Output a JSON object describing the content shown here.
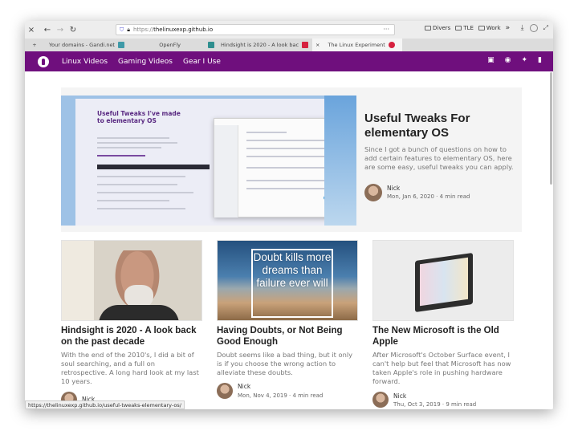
{
  "browser": {
    "url_protocol": "https://",
    "url_host": "thelinuxexp.github.io",
    "url_menu": "···",
    "bookmarks": [
      "Divers",
      "TLE",
      "Work"
    ],
    "bookmarks_overflow": "»",
    "tabs": [
      {
        "label": "Your domains - Gandi.net",
        "active": false
      },
      {
        "label": "OpenFly",
        "active": false
      },
      {
        "label": "Hindsight is 2020 - A look bac",
        "active": false
      },
      {
        "label": "The Linux Experiment",
        "active": true
      }
    ],
    "status_url": "https://thelinuxexp.github.io/useful-tweaks-elementary-os/"
  },
  "site": {
    "nav": [
      "Linux Videos",
      "Gaming Videos",
      "Gear I Use"
    ],
    "brand_color": "#6f0f7d"
  },
  "featured": {
    "title": "Useful Tweaks For elementary OS",
    "excerpt": "Since I got a bunch of questions on how to add certain features to elementary OS, here are some easy, useful tweaks you can apply.",
    "author": "Nick",
    "meta": "Mon, Jan 6, 2020 · 4 min read",
    "image_title": "Useful Tweaks I've made to elementary OS"
  },
  "cards": [
    {
      "title": "Hindsight is 2020 - A look back on the past decade",
      "excerpt": "With the end of the 2010's, I did a bit of soul searching, and a full on retrospective. A long hard look at my last 10 years.",
      "author": "Nick",
      "meta": ""
    },
    {
      "title": "Having Doubts, or Not Being Good Enough",
      "excerpt": "Doubt seems like a bad thing, but it only is if you choose the wrong action to alleviate these doubts.",
      "author": "Nick",
      "meta": "Mon, Nov 4, 2019 · 4 min read",
      "image_quote": "Doubt kills more dreams than failure ever will"
    },
    {
      "title": "The New Microsoft is the Old Apple",
      "excerpt": "After Microsoft's October Surface event, I can't help but feel that Microsoft has now taken Apple's role in pushing hardware forward.",
      "author": "Nick",
      "meta": "Thu, Oct 3, 2019 · 9 min read"
    }
  ]
}
